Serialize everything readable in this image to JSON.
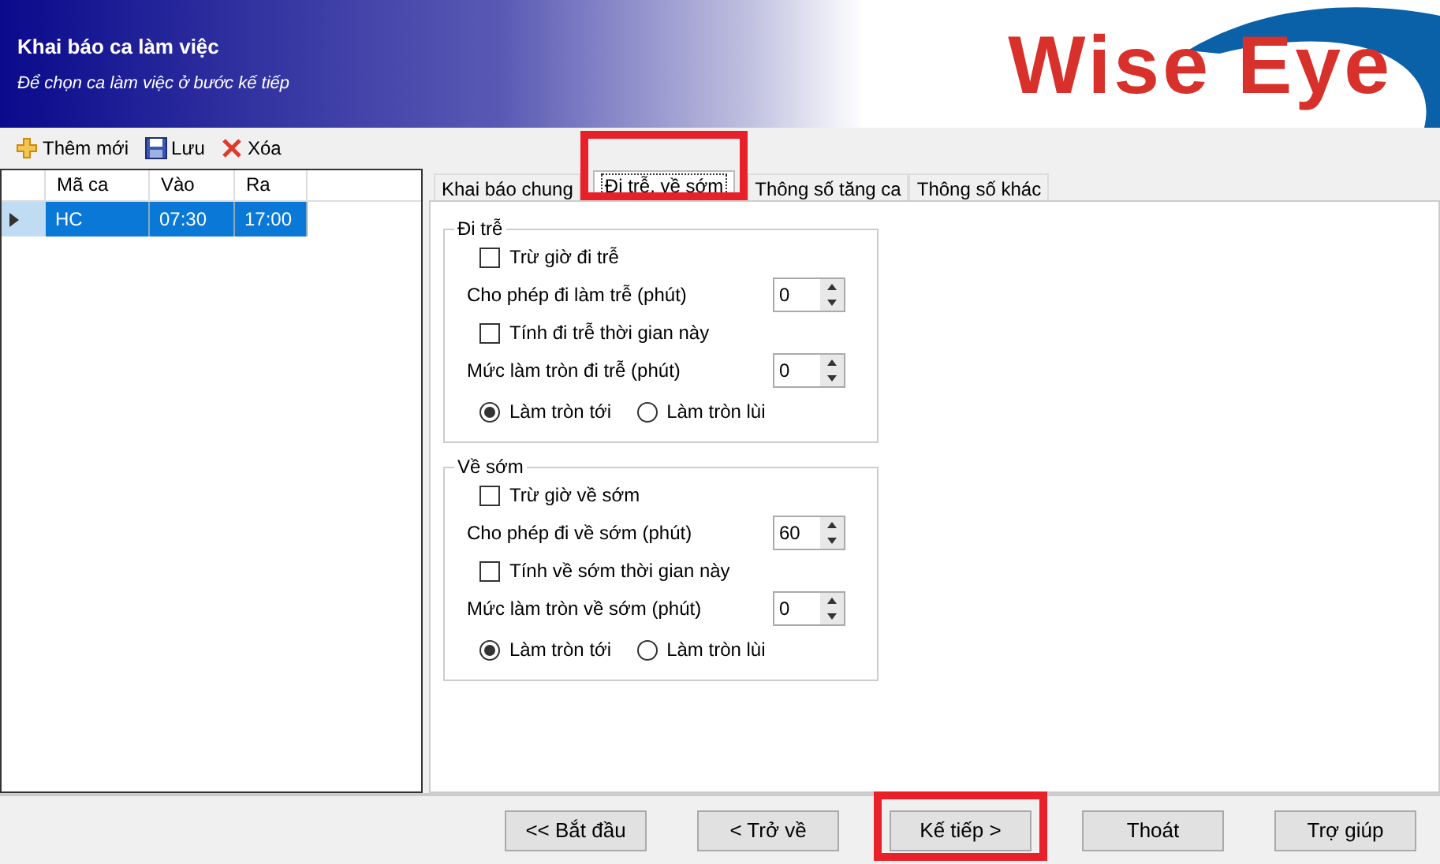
{
  "header": {
    "title": "Khai báo ca làm việc",
    "subtitle": "Để chọn ca làm việc ở bước kế tiếp",
    "logo": "Wise Eye"
  },
  "toolbar": [
    {
      "label": "Thêm mới",
      "kind": "add"
    },
    {
      "label": "Lưu",
      "kind": "save"
    },
    {
      "label": "Xóa",
      "kind": "delete"
    }
  ],
  "grid": {
    "columns": [
      "Mã ca",
      "Vào",
      "Ra"
    ],
    "rows": [
      {
        "cells": [
          "HC",
          "07:30",
          "17:00"
        ],
        "selected": true
      }
    ]
  },
  "tabs": [
    {
      "label": "Khai báo chung",
      "selected": false,
      "highlighted": false
    },
    {
      "label": "Đi trễ, về sớm",
      "selected": true,
      "highlighted": true
    },
    {
      "label": "Thông số tăng ca",
      "selected": false,
      "highlighted": false
    },
    {
      "label": "Thông số khác",
      "selected": false,
      "highlighted": false
    }
  ],
  "groups": [
    {
      "title": "Đi trễ",
      "rows": [
        {
          "kind": "checkbox",
          "label": "Trừ giờ đi trễ",
          "checked": false
        },
        {
          "kind": "spinner",
          "label": "Cho phép đi làm trễ (phút)",
          "value": "0"
        },
        {
          "kind": "checkbox",
          "label": "Tính đi trễ thời gian này",
          "checked": false
        },
        {
          "kind": "spinner",
          "label": "Mức làm tròn đi trễ (phút)",
          "value": "0"
        },
        {
          "kind": "radios",
          "options": [
            {
              "label": "Làm tròn tới",
              "selected": true
            },
            {
              "label": "Làm tròn lùi",
              "selected": false
            }
          ]
        }
      ]
    },
    {
      "title": "Về sớm",
      "rows": [
        {
          "kind": "checkbox",
          "label": "Trừ giờ về sớm",
          "checked": false
        },
        {
          "kind": "spinner",
          "label": "Cho phép đi về sớm (phút)",
          "value": "60"
        },
        {
          "kind": "checkbox",
          "label": "Tính về sớm thời gian này",
          "checked": false
        },
        {
          "kind": "spinner",
          "label": "Mức làm tròn về sớm (phút)",
          "value": "0"
        },
        {
          "kind": "radios",
          "options": [
            {
              "label": "Làm tròn tới",
              "selected": true
            },
            {
              "label": "Làm tròn lùi",
              "selected": false
            }
          ]
        }
      ]
    }
  ],
  "buttons": [
    {
      "label": "<<  Bắt đầu",
      "highlighted": false
    },
    {
      "label": "<  Trở về",
      "highlighted": false
    },
    {
      "label": "Kế tiếp >",
      "highlighted": true
    },
    {
      "label": "Thoát",
      "highlighted": false
    },
    {
      "label": "Trợ giúp",
      "highlighted": false
    }
  ]
}
